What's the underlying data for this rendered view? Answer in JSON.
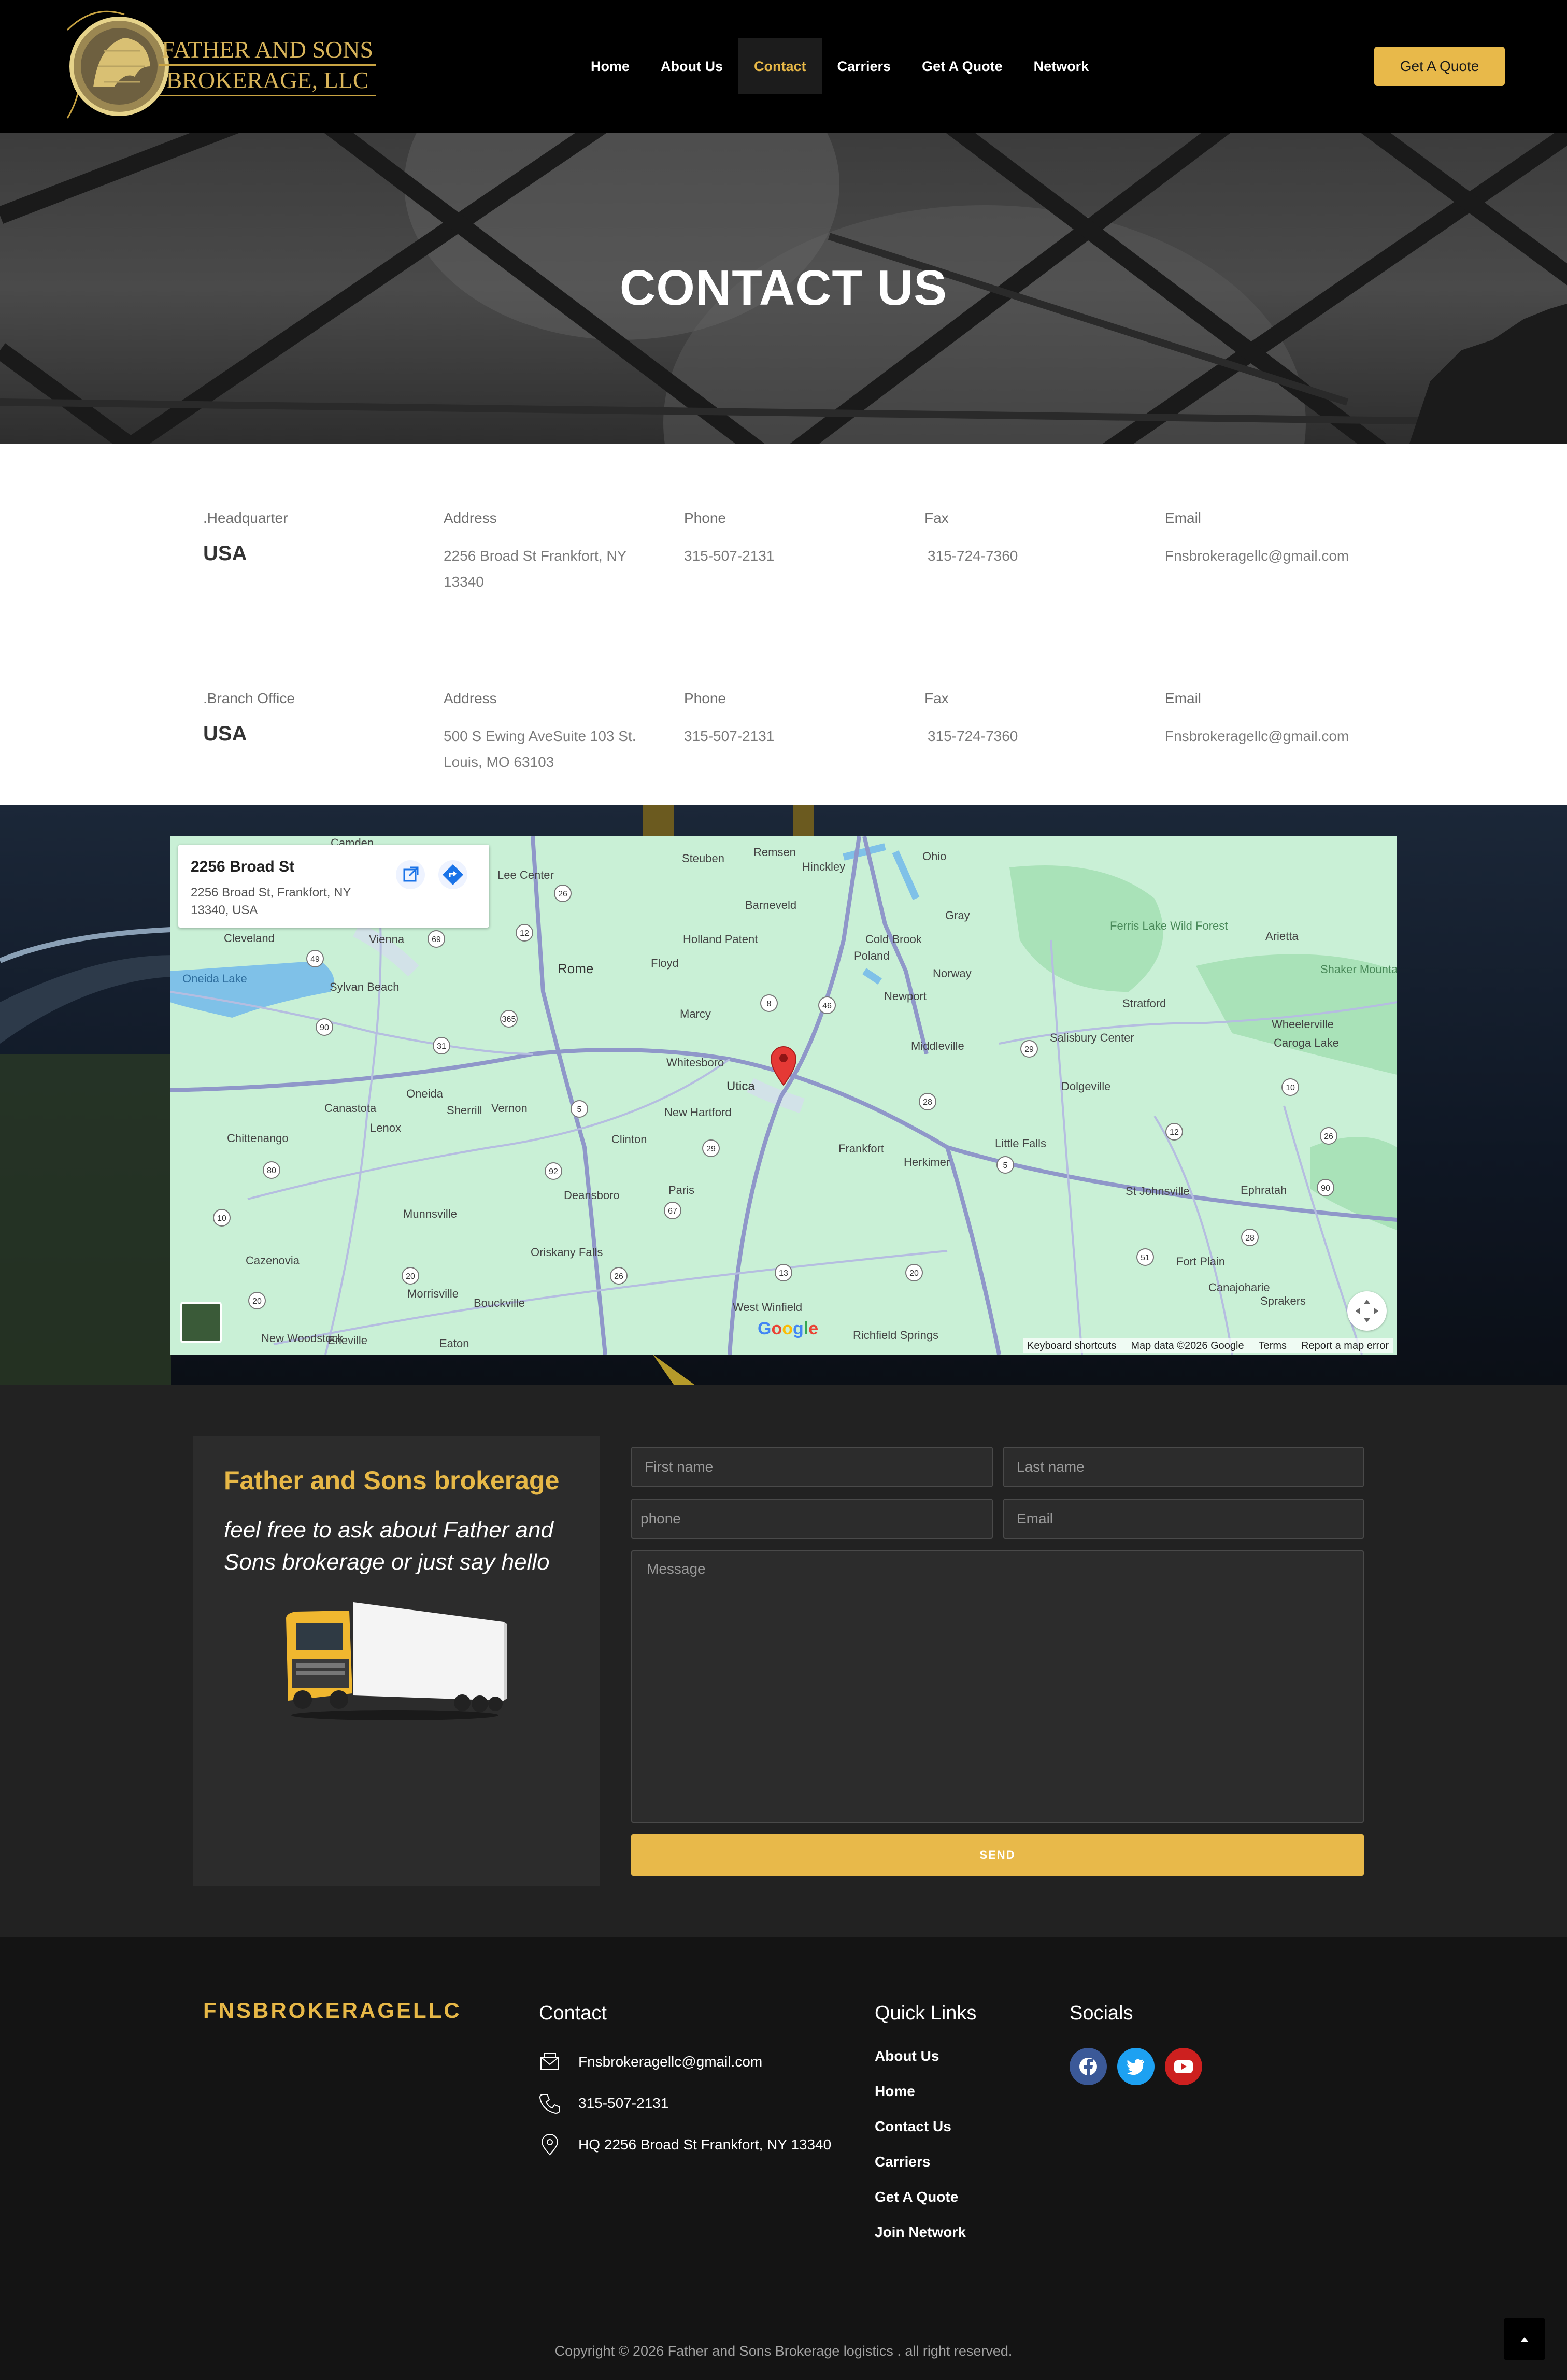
{
  "header": {
    "logo_line1": "FATHER AND SONS",
    "logo_line2": "BROKERAGE, LLC",
    "nav": [
      "Home",
      "About Us",
      "Contact",
      "Carriers",
      "Get A Quote",
      "Network"
    ],
    "active_nav": "Contact",
    "quote_button": "Get A Quote",
    "accent_color": "#e7b847"
  },
  "hero": {
    "title": "CONTACT US"
  },
  "offices": [
    {
      "type": ".Headquarter",
      "country": "USA",
      "address_label": "Address",
      "address_line1": "2256 Broad St Frankfort, NY",
      "address_line2": "13340",
      "phone_label": "Phone",
      "phone": "315-507-2131",
      "fax_label": "Fax",
      "fax": "315-724-7360",
      "email_label": "Email",
      "email": "Fnsbrokeragellc@gmail.com"
    },
    {
      "type": ".Branch Office",
      "country": "USA",
      "address_label": "Address",
      "address_line1": "500 S Ewing AveSuite 103 St.",
      "address_line2": "Louis, MO 63103",
      "phone_label": "Phone",
      "phone": "315-507-2131",
      "fax_label": "Fax",
      "fax": "315-724-7360",
      "email_label": "Email",
      "email": "Fnsbrokeragellc@gmail.com"
    }
  ],
  "map": {
    "place_title": "2256 Broad St",
    "place_address_1": "2256 Broad St, Frankfort, NY",
    "place_address_2": "13340, USA",
    "footer_links": [
      "Keyboard shortcuts",
      "Map data ©2026 Google",
      "Terms",
      "Report a map error"
    ],
    "places": [
      "Camden",
      "Steuben",
      "Remsen",
      "Ohio",
      "Hinckley",
      "Lee Center",
      "Barneveld",
      "Cleveland",
      "Vienna",
      "Rome",
      "Holland Patent",
      "Cold Brook",
      "Poland",
      "Gray",
      "Ferris Lake Wild Forest",
      "Arietta",
      "Shaker Mountain Wild Forest",
      "Oneida Lake",
      "Sylvan Beach",
      "Floyd",
      "Norway",
      "Newport",
      "Stratford",
      "Wheelerville",
      "Caroga Lake",
      "Marcy",
      "Middleville",
      "Salisbury Center",
      "Whitesboro",
      "Utica",
      "Dolgeville",
      "Canastota",
      "Oneida",
      "Sherrill",
      "Vernon",
      "New Hartford",
      "Clinton",
      "Little Falls",
      "Chittenango",
      "Lenox",
      "Frankfort",
      "Herkimer",
      "St Johnsville",
      "Ephratah",
      "Deansboro",
      "Paris",
      "Munnsville",
      "Oriskany Falls",
      "Fort Plain",
      "Cazenovia",
      "Morrisville",
      "Bouckville",
      "Canajoharie",
      "Sprakers",
      "West Winfield",
      "Richfield Springs",
      "New Woodstock",
      "Erieville",
      "Eaton"
    ],
    "route_shields": [
      "26",
      "12",
      "69",
      "49",
      "46",
      "8",
      "365",
      "31",
      "90",
      "5",
      "28",
      "29",
      "10",
      "26",
      "12",
      "5",
      "90",
      "29",
      "67",
      "92",
      "13",
      "20",
      "51",
      "28",
      "80",
      "10",
      "20",
      "26",
      "20"
    ]
  },
  "contact_form": {
    "intro_title": "Father and Sons brokerage",
    "intro_text": "feel free to ask about Father and Sons brokerage or just say hello",
    "first_name_placeholder": "First name",
    "last_name_placeholder": "Last name",
    "phone_placeholder": "phone",
    "email_placeholder": "Email",
    "message_placeholder": "Message",
    "send_label": "SEND"
  },
  "footer": {
    "brand": "FNSBROKERAGELLC",
    "contact_heading": "Contact",
    "contact_email": "Fnsbrokeragellc@gmail.com",
    "contact_phone": "315-507-2131",
    "contact_address": "HQ 2256 Broad St Frankfort, NY 13340",
    "quick_links_heading": "Quick Links",
    "quick_links": [
      "About Us",
      "Home",
      "Contact Us",
      "Carriers",
      "Get A Quote",
      "Join Network"
    ],
    "socials_heading": "Socials",
    "socials": [
      {
        "icon": "facebook-icon",
        "color": "#3b5998"
      },
      {
        "icon": "twitter-icon",
        "color": "#1da1f2"
      },
      {
        "icon": "youtube-icon",
        "color": "#cd201f"
      }
    ],
    "copyright": "Copyright © 2026 Father and Sons Brokerage logistics . all right reserved."
  }
}
